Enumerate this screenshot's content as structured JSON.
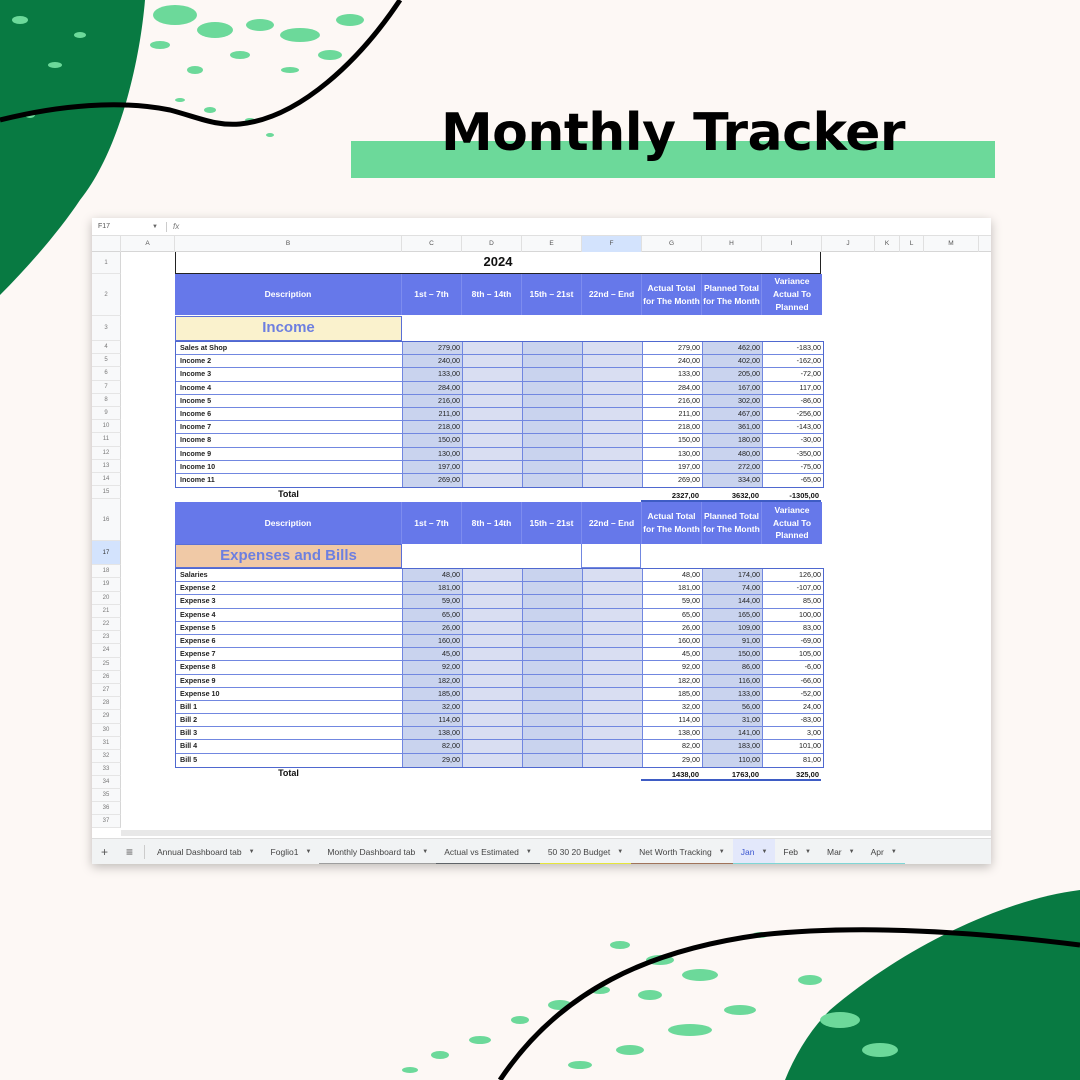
{
  "page": {
    "title": "Monthly Tracker",
    "colors": {
      "background": "#fdf8f5",
      "dark_green": "#087a42",
      "light_green": "#6cd99a",
      "header_blue": "#6678ea",
      "income_label_bg": "#faf2cd",
      "expenses_label_bg": "#f0c9a6",
      "label_text": "#6d7fe0"
    }
  },
  "spreadsheet": {
    "name_box": "F17",
    "fx_label": "fx",
    "columns": [
      "A",
      "B",
      "C",
      "D",
      "E",
      "F",
      "G",
      "H",
      "I",
      "J",
      "K",
      "L",
      "M"
    ],
    "selected_column": "F",
    "rows": [
      "1",
      "2",
      "3",
      "4",
      "5",
      "6",
      "7",
      "8",
      "9",
      "10",
      "11",
      "12",
      "13",
      "14",
      "15",
      "16",
      "17",
      "18",
      "19",
      "20",
      "21",
      "22",
      "23",
      "24",
      "25",
      "26",
      "27",
      "28",
      "29",
      "30",
      "31",
      "32",
      "33",
      "34",
      "35",
      "36",
      "37"
    ],
    "selected_row": "17",
    "year": "2024",
    "headers": {
      "description": "Description",
      "week1": "1st – 7th",
      "week2": "8th – 14th",
      "week3": "15th – 21st",
      "week4": "22nd – End",
      "actual": "Actual Total for The Month",
      "planned": "Planned Total for The Month",
      "variance": "Variance Actual To Planned"
    },
    "income": {
      "label": "Income",
      "rows": [
        {
          "desc": "Sales at Shop",
          "week1": "279,00",
          "actual": "279,00",
          "planned": "462,00",
          "variance": "-183,00"
        },
        {
          "desc": "Income 2",
          "week1": "240,00",
          "actual": "240,00",
          "planned": "402,00",
          "variance": "-162,00"
        },
        {
          "desc": "Income 3",
          "week1": "133,00",
          "actual": "133,00",
          "planned": "205,00",
          "variance": "-72,00"
        },
        {
          "desc": "Income 4",
          "week1": "284,00",
          "actual": "284,00",
          "planned": "167,00",
          "variance": "117,00"
        },
        {
          "desc": "Income 5",
          "week1": "216,00",
          "actual": "216,00",
          "planned": "302,00",
          "variance": "-86,00"
        },
        {
          "desc": "Income 6",
          "week1": "211,00",
          "actual": "211,00",
          "planned": "467,00",
          "variance": "-256,00"
        },
        {
          "desc": "Income 7",
          "week1": "218,00",
          "actual": "218,00",
          "planned": "361,00",
          "variance": "-143,00"
        },
        {
          "desc": "Income 8",
          "week1": "150,00",
          "actual": "150,00",
          "planned": "180,00",
          "variance": "-30,00"
        },
        {
          "desc": "Income 9",
          "week1": "130,00",
          "actual": "130,00",
          "planned": "480,00",
          "variance": "-350,00"
        },
        {
          "desc": "Income 10",
          "week1": "197,00",
          "actual": "197,00",
          "planned": "272,00",
          "variance": "-75,00"
        },
        {
          "desc": "Income 11",
          "week1": "269,00",
          "actual": "269,00",
          "planned": "334,00",
          "variance": "-65,00"
        }
      ],
      "total": {
        "label": "Total",
        "actual": "2327,00",
        "planned": "3632,00",
        "variance": "-1305,00"
      }
    },
    "expenses": {
      "label": "Expenses and Bills",
      "rows": [
        {
          "desc": "Salaries",
          "week1": "48,00",
          "actual": "48,00",
          "planned": "174,00",
          "variance": "126,00"
        },
        {
          "desc": "Expense 2",
          "week1": "181,00",
          "actual": "181,00",
          "planned": "74,00",
          "variance": "-107,00"
        },
        {
          "desc": "Expense 3",
          "week1": "59,00",
          "actual": "59,00",
          "planned": "144,00",
          "variance": "85,00"
        },
        {
          "desc": "Expense 4",
          "week1": "65,00",
          "actual": "65,00",
          "planned": "165,00",
          "variance": "100,00"
        },
        {
          "desc": "Expense 5",
          "week1": "26,00",
          "actual": "26,00",
          "planned": "109,00",
          "variance": "83,00"
        },
        {
          "desc": "Expense 6",
          "week1": "160,00",
          "actual": "160,00",
          "planned": "91,00",
          "variance": "-69,00"
        },
        {
          "desc": "Expense 7",
          "week1": "45,00",
          "actual": "45,00",
          "planned": "150,00",
          "variance": "105,00"
        },
        {
          "desc": "Expense 8",
          "week1": "92,00",
          "actual": "92,00",
          "planned": "86,00",
          "variance": "-6,00"
        },
        {
          "desc": "Expense 9",
          "week1": "182,00",
          "actual": "182,00",
          "planned": "116,00",
          "variance": "-66,00"
        },
        {
          "desc": "Expense 10",
          "week1": "185,00",
          "actual": "185,00",
          "planned": "133,00",
          "variance": "-52,00"
        },
        {
          "desc": "Bill 1",
          "week1": "32,00",
          "actual": "32,00",
          "planned": "56,00",
          "variance": "24,00"
        },
        {
          "desc": "Bill 2",
          "week1": "114,00",
          "actual": "114,00",
          "planned": "31,00",
          "variance": "-83,00"
        },
        {
          "desc": "Bill 3",
          "week1": "138,00",
          "actual": "138,00",
          "planned": "141,00",
          "variance": "3,00"
        },
        {
          "desc": "Bill 4",
          "week1": "82,00",
          "actual": "82,00",
          "planned": "183,00",
          "variance": "101,00"
        },
        {
          "desc": "Bill 5",
          "week1": "29,00",
          "actual": "29,00",
          "planned": "110,00",
          "variance": "81,00"
        }
      ],
      "total": {
        "label": "Total",
        "actual": "1438,00",
        "planned": "1763,00",
        "variance": "325,00"
      }
    },
    "tab_bar": {
      "add_icon": "+",
      "menu_icon": "≡",
      "tabs": [
        {
          "label": "Annual Dashboard tab",
          "color": "#f1f3f4",
          "active": false
        },
        {
          "label": "Foglio1",
          "color": "#f1f3f4",
          "active": false
        },
        {
          "label": "Monthly Dashboard tab",
          "color": "#9e9e9e",
          "active": false
        },
        {
          "label": "Actual vs Estimated",
          "color": "#5f6368",
          "active": false
        },
        {
          "label": "50 30 20 Budget",
          "color": "#e6e53a",
          "active": false
        },
        {
          "label": "Net Worth Tracking",
          "color": "#a0735a",
          "active": false
        },
        {
          "label": "Jan",
          "color": "#7fd6d6",
          "active": true
        },
        {
          "label": "Feb",
          "color": "#7fd6d6",
          "active": false
        },
        {
          "label": "Mar",
          "color": "#7fd6d6",
          "active": false
        },
        {
          "label": "Apr",
          "color": "#7fd6d6",
          "active": false
        }
      ]
    }
  }
}
